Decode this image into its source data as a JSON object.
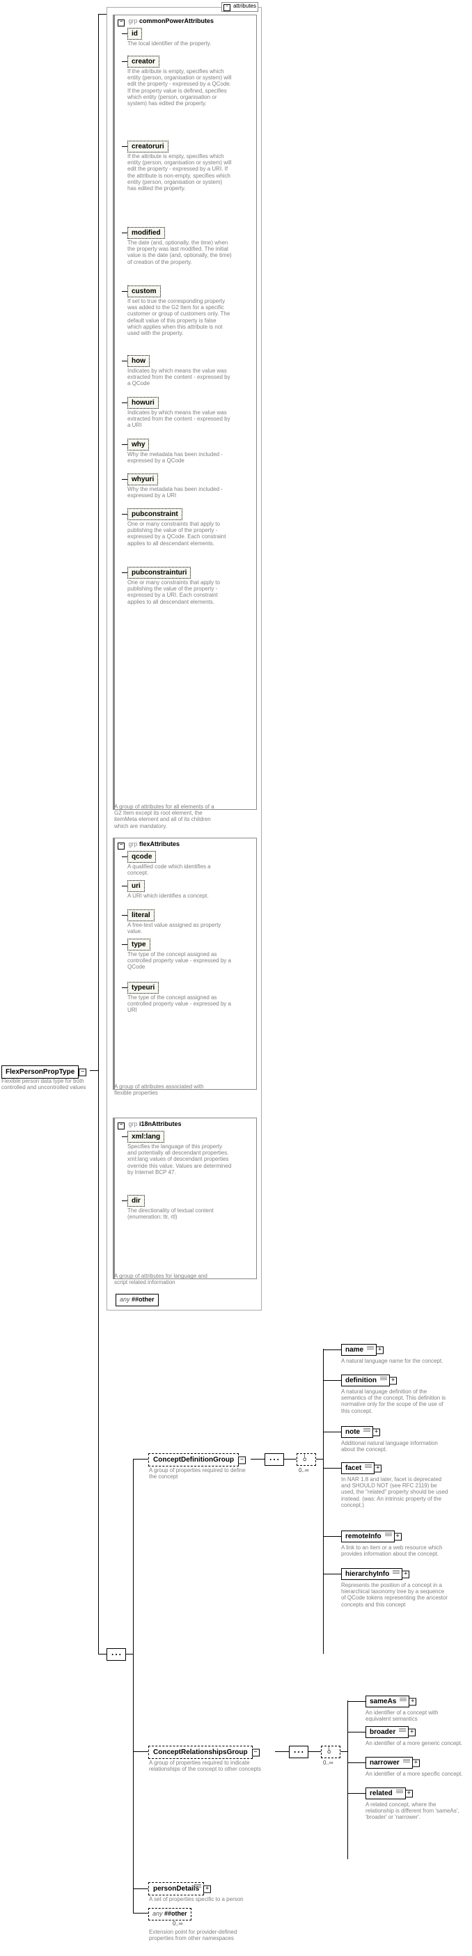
{
  "root": {
    "name": "FlexPersonPropType",
    "desc": "Flexible person data type for both controlled and uncontrolled values"
  },
  "attrHeader": "attributes",
  "grpPrefix": "grp",
  "expandMinus": "−",
  "expandPlus": "+",
  "commonPowerAttributes": {
    "name": "commonPowerAttributes",
    "desc": "A group of attributes for all elements of a G2 Item except its root element, the itemMeta element and all of its children which are mandatory.",
    "items": [
      {
        "name": "id",
        "desc": "The local identifier of the property."
      },
      {
        "name": "creator",
        "desc": "If the attribute is empty, specifies which entity (person, organisation or system) will edit the property - expressed by a QCode. If the property value is defined, specifies which entity (person, organisation or system) has edited the property."
      },
      {
        "name": "creatoruri",
        "desc": "If the attribute is empty, specifies which entity (person, organisation or system) will edit the property - expressed by a URI. If the attribute is non-empty, specifies which entity (person, organisation or system) has edited the property."
      },
      {
        "name": "modified",
        "desc": "The date (and, optionally, the time) when the property was last modified. The initial value is the date (and, optionally, the time) of creation of the property."
      },
      {
        "name": "custom",
        "desc": "If set to true the corresponding property was added to the G2 Item for a specific customer or group of customers only. The default value of this property is false which applies when this attribute is not used with the property."
      },
      {
        "name": "how",
        "desc": "Indicates by which means the value was extracted from the content - expressed by a QCode"
      },
      {
        "name": "howuri",
        "desc": "Indicates by which means the value was extracted from the content - expressed by a URI"
      },
      {
        "name": "why",
        "desc": "Why the metadata has been included - expressed by a QCode"
      },
      {
        "name": "whyuri",
        "desc": "Why the metadata has been included - expressed by a URI"
      },
      {
        "name": "pubconstraint",
        "desc": "One or many constraints that apply to publishing the value of the property - expressed by a QCode. Each constraint applies to all descendant elements."
      },
      {
        "name": "pubconstrainturi",
        "desc": "One or many constraints that apply to publishing the value of the property - expressed by a URI. Each constraint applies to all descendant elements."
      }
    ]
  },
  "flexAttributes": {
    "name": "flexAttributes",
    "desc": "A group of attributes associated with flexible properties",
    "items": [
      {
        "name": "qcode",
        "desc": "A qualified code which identifies a concept."
      },
      {
        "name": "uri",
        "desc": "A URI which identifies a concept."
      },
      {
        "name": "literal",
        "desc": "A free-text value assigned as property value."
      },
      {
        "name": "type",
        "desc": "The type of the concept assigned as controlled property value - expressed by a QCode"
      },
      {
        "name": "typeuri",
        "desc": "The type of the concept assigned as controlled property value - expressed by a URI"
      }
    ]
  },
  "i18nAttributes": {
    "name": "i18nAttributes",
    "desc": "A group of attributes for language and script related information",
    "items": [
      {
        "name": "xml:lang",
        "desc": "Specifies the language of this property and potentially all descendant properties. xml:lang values of descendant properties override this value. Values are determined by Internet BCP 47."
      },
      {
        "name": "dir",
        "desc": "The directionality of textual content (enumeration: ltr, rtl)"
      }
    ]
  },
  "wildcard1": "any ##other",
  "conceptDefinitionGroup": {
    "name": "ConceptDefinitionGroup",
    "desc": "A group of properties required to define the concept",
    "items": [
      {
        "name": "name",
        "desc": "A natural language name for the concept."
      },
      {
        "name": "definition",
        "desc": "A natural language definition of the semantics of the concept. This definition is normative only for the scope of the use of this concept."
      },
      {
        "name": "note",
        "desc": "Additional natural language information about the concept."
      },
      {
        "name": "facet",
        "desc": "In NAR 1.8 and later, facet is deprecated and SHOULD NOT (see RFC 2119) be used, the \"related\" property should be used instead. (was: An intrinsic property of the concept.)"
      },
      {
        "name": "remoteInfo",
        "desc": "A link to an item or a web resource which provides information about the concept."
      },
      {
        "name": "hierarchyInfo",
        "desc": "Represents the position of a concept in a hierarchical taxonomy tree by a sequence of QCode tokens representing the ancestor concepts and this concept"
      }
    ]
  },
  "conceptRelationshipsGroup": {
    "name": "ConceptRelationshipsGroup",
    "desc": "A group of properties required to indicate relationships of the concept to other concepts",
    "items": [
      {
        "name": "sameAs",
        "desc": "An identifier of a concept with equivalent semantics"
      },
      {
        "name": "broader",
        "desc": "An identifier of a more generic concept."
      },
      {
        "name": "narrower",
        "desc": "An identifier of a more specific concept."
      },
      {
        "name": "related",
        "desc": "A related concept, where the relationship is different from 'sameAs', 'broader' or 'narrower'."
      }
    ]
  },
  "personDetails": {
    "name": "personDetails",
    "desc": "A set of properties specific to a person"
  },
  "wildcard2": {
    "label": "any ##other",
    "desc": "Extension point for provider-defined properties from other namespaces",
    "card": "0..∞"
  },
  "card_0_inf": "0..∞"
}
